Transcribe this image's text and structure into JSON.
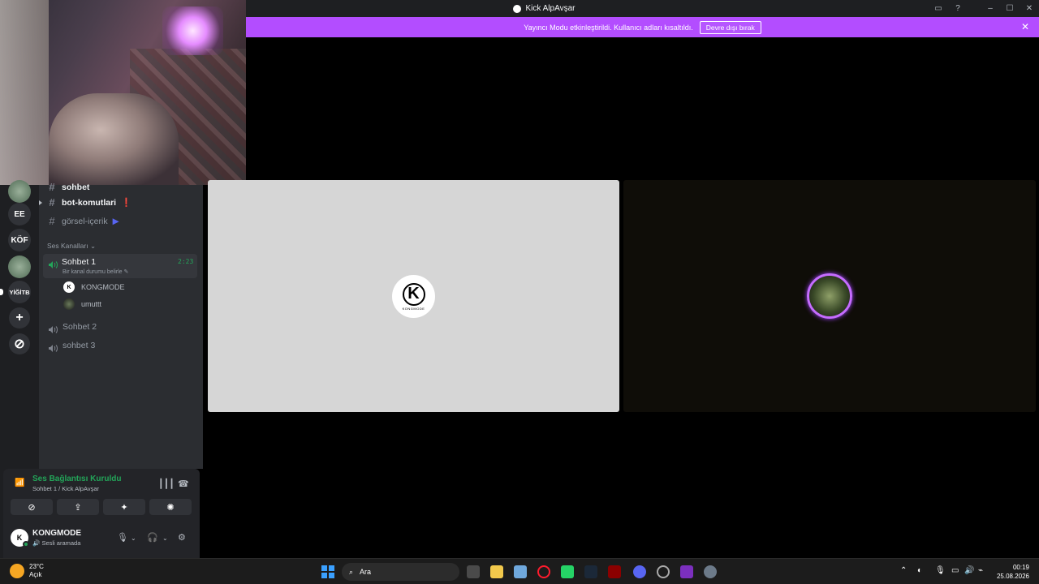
{
  "window": {
    "title": "Kick AlpAvşar"
  },
  "banner": {
    "text": "Yayıncı Modu etkinleştirildi. Kullanıcı adları kısaltıldı.",
    "button": "Devre dışı bırak"
  },
  "servers": [
    {
      "label": "EE"
    },
    {
      "label": "KÖF"
    },
    {
      "label": "YİĞİTB"
    }
  ],
  "channels": {
    "text": [
      {
        "name": "sohbet"
      },
      {
        "name": "bot-komutlari"
      },
      {
        "name": "görsel-içerik"
      }
    ],
    "voice_category": "Ses Kanalları",
    "voice": [
      {
        "name": "Sohbet 1",
        "status_prompt": "Bir kanal durumu belirle",
        "time": "2:23",
        "members": [
          {
            "name": "KONGMODE"
          },
          {
            "name": "umuttt"
          }
        ]
      },
      {
        "name": "Sohbet 2"
      },
      {
        "name": "sohbet 3"
      }
    ]
  },
  "voice_panel": {
    "status": "Ses Bağlantısı Kuruldu",
    "location": "Sohbet 1 / Kick AlpAvşar"
  },
  "user": {
    "name": "KONGMODE",
    "status": "Sesli aramada",
    "avatar_letter": "K"
  },
  "stage": {
    "left_avatar_letter": "K",
    "left_avatar_caption": "KONGMODE"
  },
  "taskbar": {
    "weather_temp": "23°C",
    "weather_desc": "Açık",
    "search_placeholder": "Ara",
    "time": "00:19",
    "date": "25.08.2026"
  },
  "colors": {
    "banner": "#b34dff",
    "speaking_ring": "#c56cff",
    "connected": "#23a559"
  }
}
